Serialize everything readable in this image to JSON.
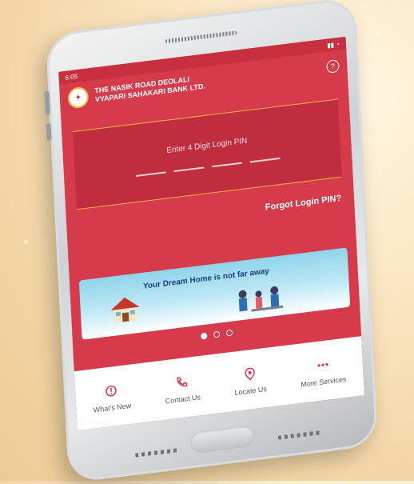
{
  "status": {
    "time": "6:05"
  },
  "bank": {
    "name_line1": "THE NASIK ROAD DEOLALI",
    "name_line2": "VYAPARI SAHAKARI BANK LTD."
  },
  "pin": {
    "label": "Enter 4 Digit Login PIN",
    "digits": 4
  },
  "forgot_label": "Forgot Login PIN?",
  "banner": {
    "text": "Your Dream Home is not far away",
    "active_slide": 1,
    "slide_count": 3
  },
  "nav": [
    {
      "label": "What's New",
      "icon": "alert-icon"
    },
    {
      "label": "Contact Us",
      "icon": "phone-icon"
    },
    {
      "label": "Locate Us",
      "icon": "location-pin-icon"
    },
    {
      "label": "More Services",
      "icon": "more-dots-icon"
    }
  ],
  "colors": {
    "primary": "#d63b4c",
    "accent": "#f0b44a"
  }
}
